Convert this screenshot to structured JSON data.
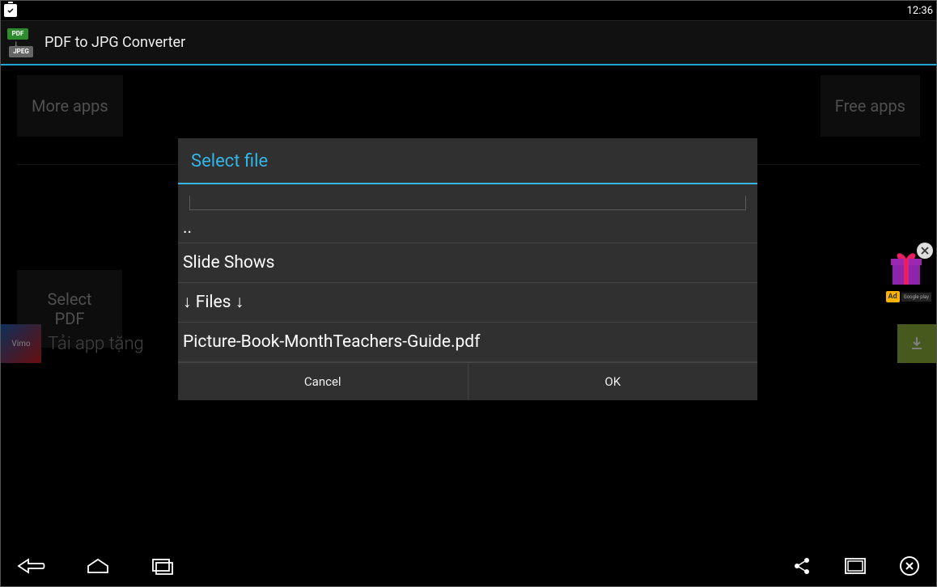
{
  "status": {
    "time": "12:36"
  },
  "app": {
    "title": "PDF to JPG Converter",
    "logo_pdf": "PDF",
    "logo_jpeg": "JPEG"
  },
  "buttons": {
    "more_apps": "More apps",
    "free_apps": "Free apps",
    "select_pdf": "Select PDF"
  },
  "ad": {
    "vimo": "Vimo",
    "text": "Tải app tặng",
    "badge": "Ad",
    "google_play": "Google play"
  },
  "dialog": {
    "title": "Select file",
    "items": {
      "parent": "..",
      "folder1": "Slide Shows",
      "files_divider": "↓ Files ↓",
      "file1": "Picture-Book-MonthTeachers-Guide.pdf"
    },
    "cancel": "Cancel",
    "ok": "OK"
  }
}
